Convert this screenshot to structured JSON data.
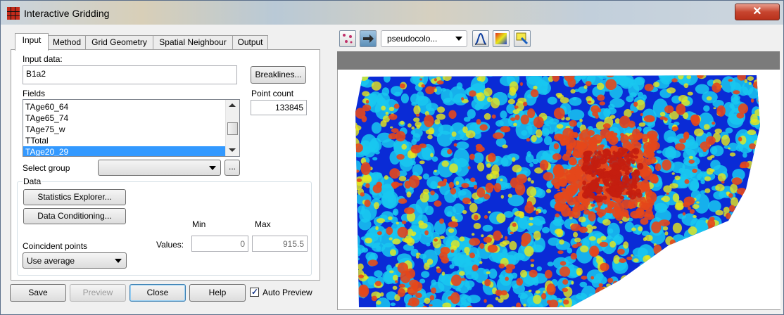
{
  "window": {
    "title": "Interactive Gridding",
    "close_glyph": "✕"
  },
  "tabs": [
    {
      "label": "Input",
      "active": true
    },
    {
      "label": "Method",
      "active": false
    },
    {
      "label": "Grid Geometry",
      "active": false
    },
    {
      "label": "Spatial Neighbour",
      "active": false
    },
    {
      "label": "Output",
      "active": false
    }
  ],
  "input": {
    "input_data_label": "Input data:",
    "input_data_value": "B1a2",
    "breaklines_button": "Breaklines...",
    "fields_label": "Fields",
    "fields": [
      "TAge60_64",
      "TAge65_74",
      "TAge75_w",
      "TTotal",
      "TAge20_29"
    ],
    "selected_field": "TAge20_29",
    "point_count_label": "Point count",
    "point_count_value": "133845",
    "select_group_label": "Select group",
    "select_group_value": "",
    "browse_button": "...",
    "data_group_label": "Data",
    "statistics_button": "Statistics Explorer...",
    "conditioning_button": "Data Conditioning...",
    "min_label": "Min",
    "max_label": "Max",
    "values_label": "Values:",
    "min_value": "0",
    "max_value": "915.5",
    "coincident_label": "Coincident points",
    "coincident_value": "Use average"
  },
  "footer": {
    "save": "Save",
    "preview": "Preview",
    "close": "Close",
    "help": "Help",
    "auto_preview_label": "Auto Preview",
    "auto_preview_checked": true,
    "checkmark": "✓"
  },
  "preview_toolbar": {
    "colour_mode": "pseudocolo...",
    "icons": [
      "points-icon",
      "arrow-icon",
      "histogram-icon",
      "colour-table-icon",
      "annotate-icon"
    ]
  },
  "map": {
    "colours": {
      "low": "#0a2bd6",
      "mid": "#19c8f0",
      "high": "#e4471b",
      "peak": "#c41e10",
      "yellow": "#e8e81a"
    }
  }
}
